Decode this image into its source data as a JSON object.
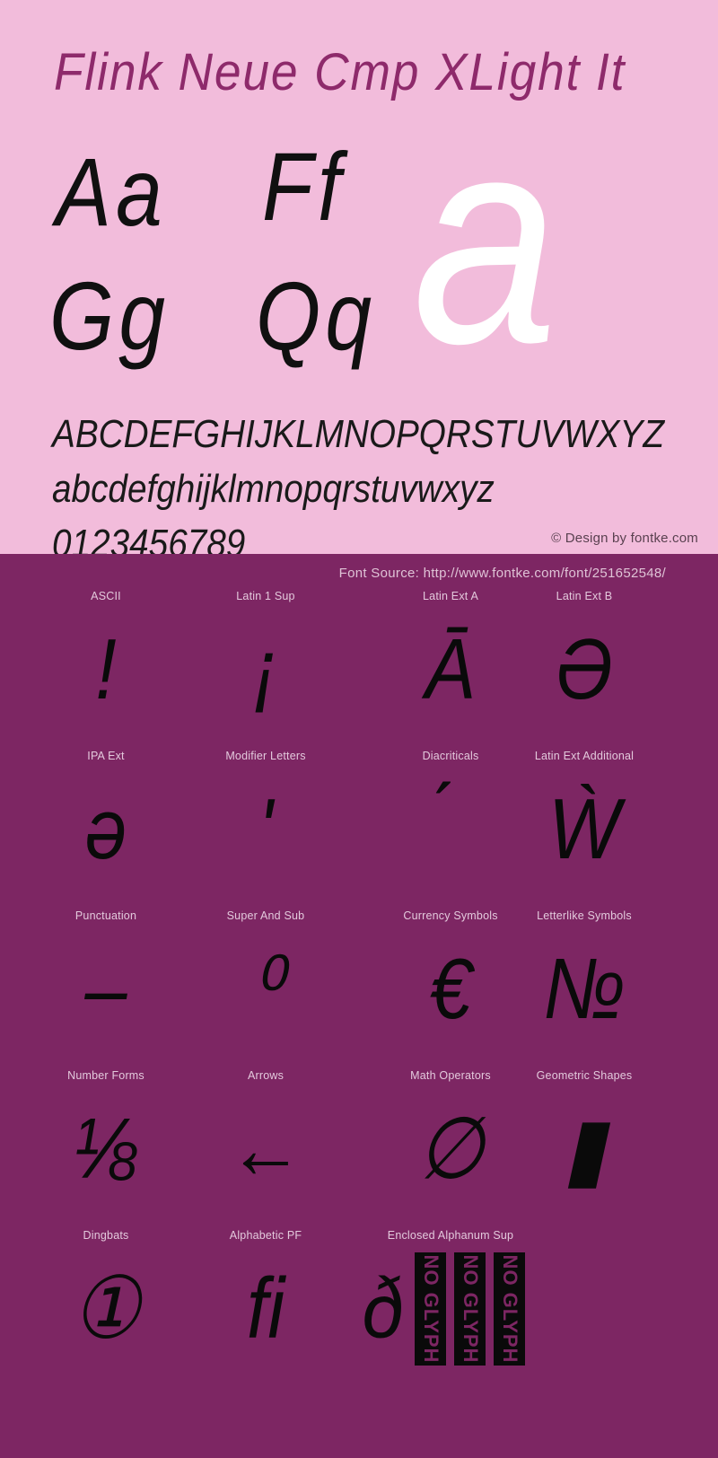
{
  "specimen": {
    "font_title": "Flink Neue Cmp XLight It",
    "pairs": [
      {
        "name": "pair-aa",
        "text": "Aa"
      },
      {
        "name": "pair-ff",
        "text": "Ff"
      },
      {
        "name": "pair-gg",
        "text": "Gg"
      },
      {
        "name": "pair-qq",
        "text": "Qq"
      }
    ],
    "big_glyph": "a",
    "alphabet_uppercase": "ABCDEFGHIJKLMNOPQRSTUVWXYZ",
    "alphabet_lowercase": "abcdefghijklmnopqrstuvwxyz",
    "digits": "0123456789",
    "copyright": "© Design by fontke.com",
    "colors": {
      "panel_background": "#f2bcdb",
      "title_color": "#8e2a6b",
      "glyph_color": "#101010",
      "big_glyph_color": "#ffffff"
    }
  },
  "blocks": {
    "font_source": "Font Source: http://www.fontke.com/font/251652548/",
    "colors": {
      "panel_background": "#7d2663",
      "label_color": "#e3c9dc",
      "sample_color": "#0a0a0a"
    },
    "no_glyph_label": "NO GLYPH",
    "rows": [
      {
        "cells": [
          {
            "label": "ASCII",
            "sample": "!",
            "no_glyph_count": 0
          },
          {
            "label": "Latin 1 Sup",
            "sample": "¡",
            "no_glyph_count": 0
          },
          {
            "label": "Latin Ext A",
            "sample": "Ā",
            "no_glyph_count": 0
          },
          {
            "label": "Latin Ext B",
            "sample": "Ə",
            "no_glyph_count": 0
          }
        ]
      },
      {
        "cells": [
          {
            "label": "IPA Ext",
            "sample": "ə",
            "no_glyph_count": 0
          },
          {
            "label": "Modifier Letters",
            "sample": "ʹ",
            "no_glyph_count": 0
          },
          {
            "label": "Diacriticals",
            "sample": "́",
            "no_glyph_count": 0
          },
          {
            "label": "Latin Ext Additional",
            "sample": "Ẁ",
            "no_glyph_count": 0
          }
        ]
      },
      {
        "cells": [
          {
            "label": "Punctuation",
            "sample": "–",
            "no_glyph_count": 0
          },
          {
            "label": "Super And Sub",
            "sample": "⁰",
            "no_glyph_count": 0
          },
          {
            "label": "Currency Symbols",
            "sample": "€",
            "no_glyph_count": 0
          },
          {
            "label": "Letterlike Symbols",
            "sample": "№",
            "no_glyph_count": 0
          }
        ]
      },
      {
        "cells": [
          {
            "label": "Number Forms",
            "sample": "⅛",
            "no_glyph_count": 0
          },
          {
            "label": "Arrows",
            "sample": "←",
            "no_glyph_count": 0
          },
          {
            "label": "Math Operators",
            "sample": "∅",
            "no_glyph_count": 0
          },
          {
            "label": "Geometric Shapes",
            "sample": "▮",
            "no_glyph_count": 0
          }
        ]
      },
      {
        "cells": [
          {
            "label": "Dingbats",
            "sample": "①",
            "no_glyph_count": 0
          },
          {
            "label": "Alphabetic PF",
            "sample": "ﬁ",
            "no_glyph_count": 0
          },
          {
            "label": "Enclosed Alphanum Sup",
            "sample": "ð",
            "no_glyph_count": 3
          },
          {
            "label": "",
            "sample": "",
            "no_glyph_count": 0
          }
        ]
      }
    ]
  }
}
